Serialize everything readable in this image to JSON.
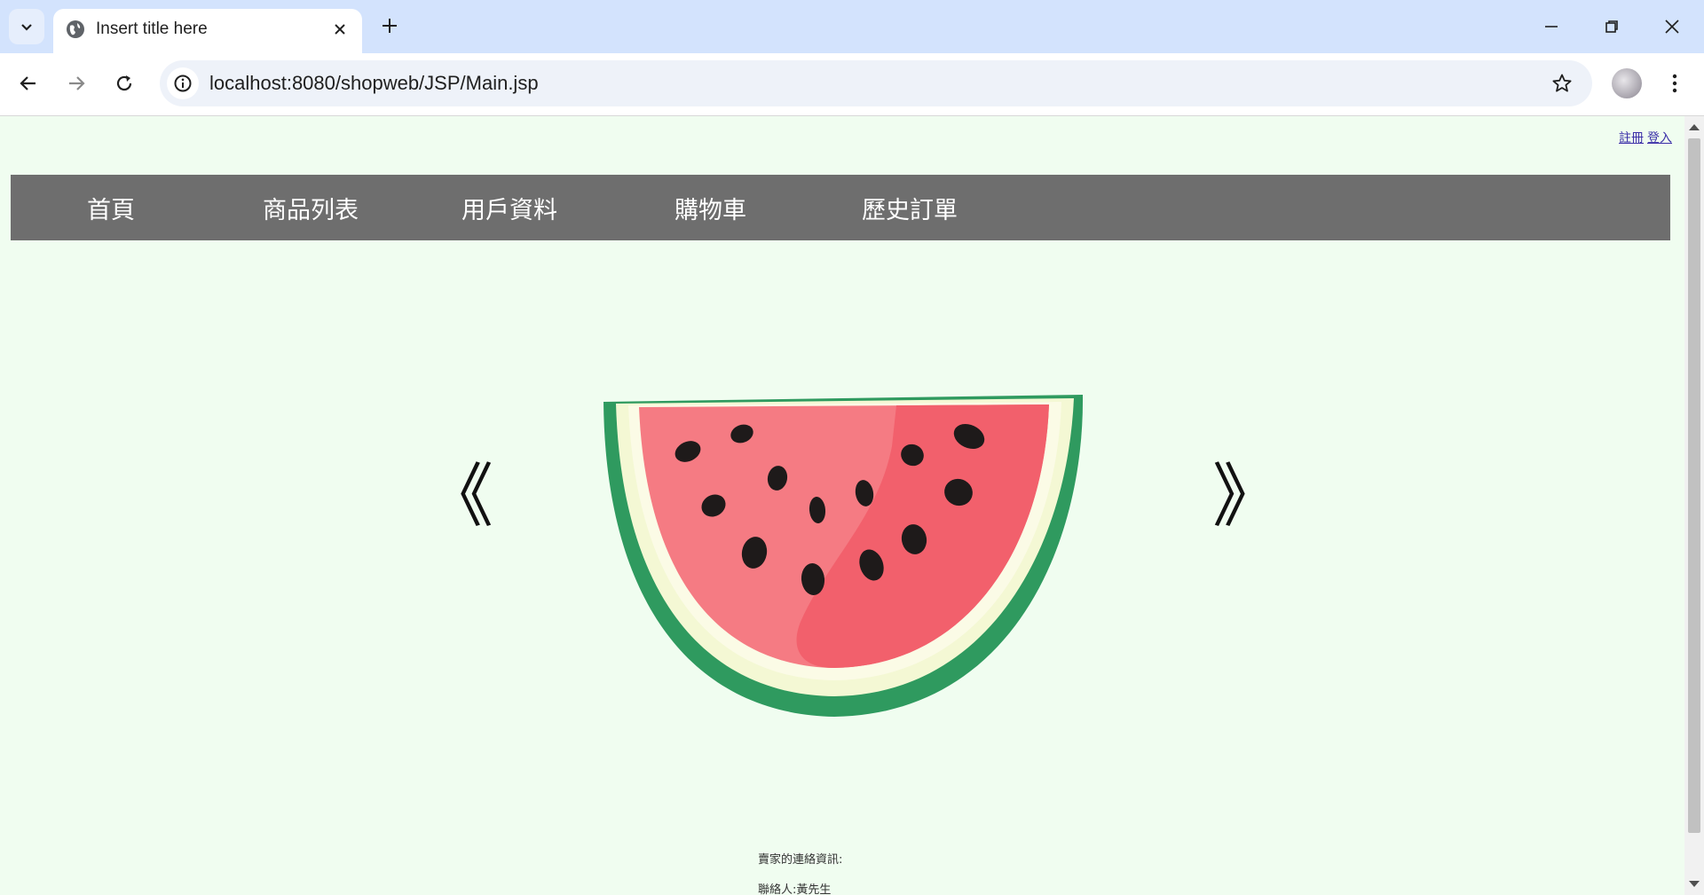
{
  "browser": {
    "tab_title": "Insert title here",
    "url": "localhost:8080/shopweb/JSP/Main.jsp"
  },
  "page": {
    "auth_links": {
      "register": "註冊",
      "login": "登入"
    },
    "nav": [
      "首頁",
      "商品列表",
      "用戶資料",
      "購物車",
      "歷史訂單"
    ],
    "carousel": {
      "prev_label": "《",
      "next_label": "》",
      "image_alt": "watermelon slice"
    },
    "contact": {
      "heading": "賣家的連絡資訊:",
      "person": "聯絡人:黃先生"
    }
  },
  "colors": {
    "tabstrip": "#d3e3fd",
    "page_background": "#f0fdf0",
    "nav_background": "#6e6e6e",
    "nav_text": "#ffffff"
  },
  "icons": {
    "tab_search": "chevron-down-icon",
    "favicon": "globe-icon",
    "tab_close": "close-icon",
    "new_tab": "plus-icon",
    "back": "arrow-left-icon",
    "forward": "arrow-right-icon",
    "reload": "reload-icon",
    "site_info": "info-icon",
    "bookmark": "star-icon",
    "menu": "kebab-menu-icon"
  }
}
